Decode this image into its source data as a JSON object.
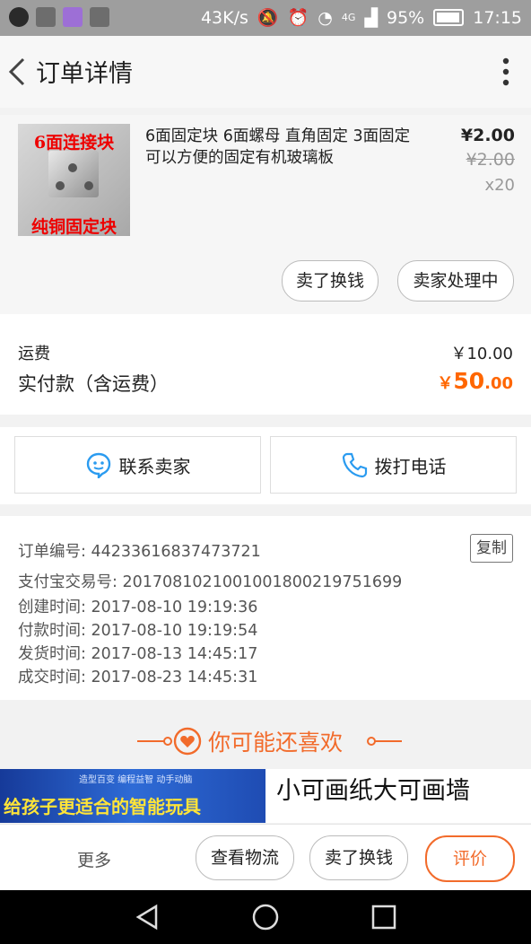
{
  "status_bar": {
    "net_speed": "43K/s",
    "network": "4G",
    "battery": "95%",
    "time": "17:15"
  },
  "header": {
    "title": "订单详情"
  },
  "product": {
    "image_text_top": "6面连接块",
    "image_text_bottom": "纯铜固定块",
    "name": "6面固定块 6面螺母 直角固定 3面固定 可以方便的固定有机玻璃板",
    "price": "¥2.00",
    "original_price": "¥2.00",
    "quantity": "x20",
    "sell_label": "卖了换钱",
    "seller_processing_label": "卖家处理中"
  },
  "fees": {
    "shipping_label": "运费",
    "shipping_value": "￥10.00",
    "paid_label": "实付款（含运费）",
    "paid_currency": "￥",
    "paid_integer": "50",
    "paid_decimal": ".00"
  },
  "contact": {
    "seller_label": "联系卖家",
    "call_label": "拨打电话"
  },
  "order_info": {
    "order_no_label": "订单编号:",
    "order_no": "44233616837473721",
    "copy_label": "复制",
    "alipay_label": "支付宝交易号:",
    "alipay_no": "2017081021001001800219751699",
    "created_label": "创建时间:",
    "created": "2017-08-10 19:19:36",
    "paid_time_label": "付款时间:",
    "paid_time": "2017-08-10 19:19:54",
    "shipped_label": "发货时间:",
    "shipped": "2017-08-13 14:45:17",
    "completed_label": "成交时间:",
    "completed": "2017-08-23 14:45:31"
  },
  "recommend": {
    "title": "你可能还喜欢"
  },
  "banners": {
    "left_sub": "造型百变  编程益智  动手动脑",
    "left_main": "给孩子更适合的智能玩具",
    "right_main": "小可画纸大可画墙"
  },
  "bottom_bar": {
    "more": "更多",
    "logistics": "查看物流",
    "sell": "卖了换钱",
    "review": "评价"
  },
  "colors": {
    "accent": "#f26b2b",
    "status_bar": "#9e9e9e"
  }
}
